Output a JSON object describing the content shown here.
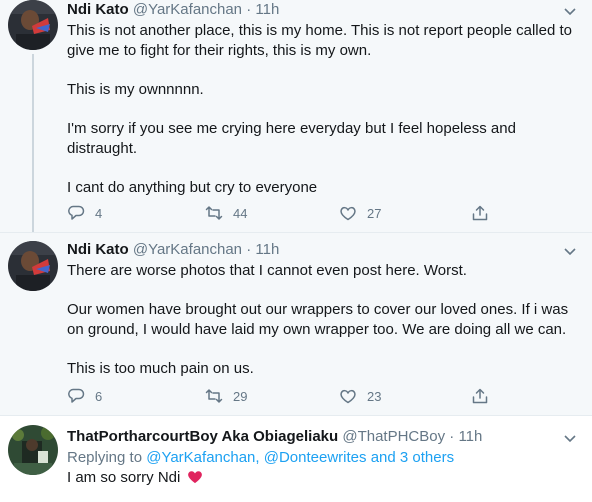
{
  "tweets": [
    {
      "name": "Ndi Kato",
      "handle": "@YarKafanchan",
      "dot": "·",
      "time": "11h",
      "lines": [
        "This is not another place,  this is my home. This is not report people called to",
        "give me to fight for their rights, this is my own.",
        "This is my ownnnnn.",
        "I'm sorry if you see me crying here everyday but I feel hopeless and",
        "distraught.",
        "I cant do anything but cry to everyone"
      ],
      "replies": "4",
      "retweets": "44",
      "likes": "27"
    },
    {
      "name": "Ndi Kato",
      "handle": "@YarKafanchan",
      "dot": "·",
      "time": "11h",
      "lines": [
        "There are worse photos that I cannot even post here. Worst.",
        "Our women have brought out our wrappers to cover our loved ones. If i was",
        "on ground, I would have laid my own wrapper too. We are doing all we can.",
        "This is too much pain on us."
      ],
      "replies": "6",
      "retweets": "29",
      "likes": "23"
    },
    {
      "name": "ThatPortharcourtBoy Aka Obiageliaku",
      "handle": "@ThatPHCBoy",
      "dot": "·",
      "time": "11h",
      "replying_prefix": "Replying to",
      "replying_users": "@YarKafanchan, @Donteewrites",
      "replying_and": "and",
      "replying_others": "3 others",
      "text": "I am so sorry Ndi"
    }
  ],
  "icons": {
    "reply": "speech-bubble-icon",
    "retweet": "retweet-icon",
    "like": "heart-outline-icon",
    "share": "share-icon",
    "caret": "chevron-down-icon",
    "heart_emoji": "red-heart-icon"
  },
  "colors": {
    "link": "#1da1f2",
    "secondary_text": "#657786",
    "icon": "#657786",
    "heart": "#e0245e",
    "selected_tweet_bg": "#f5f8fa"
  }
}
